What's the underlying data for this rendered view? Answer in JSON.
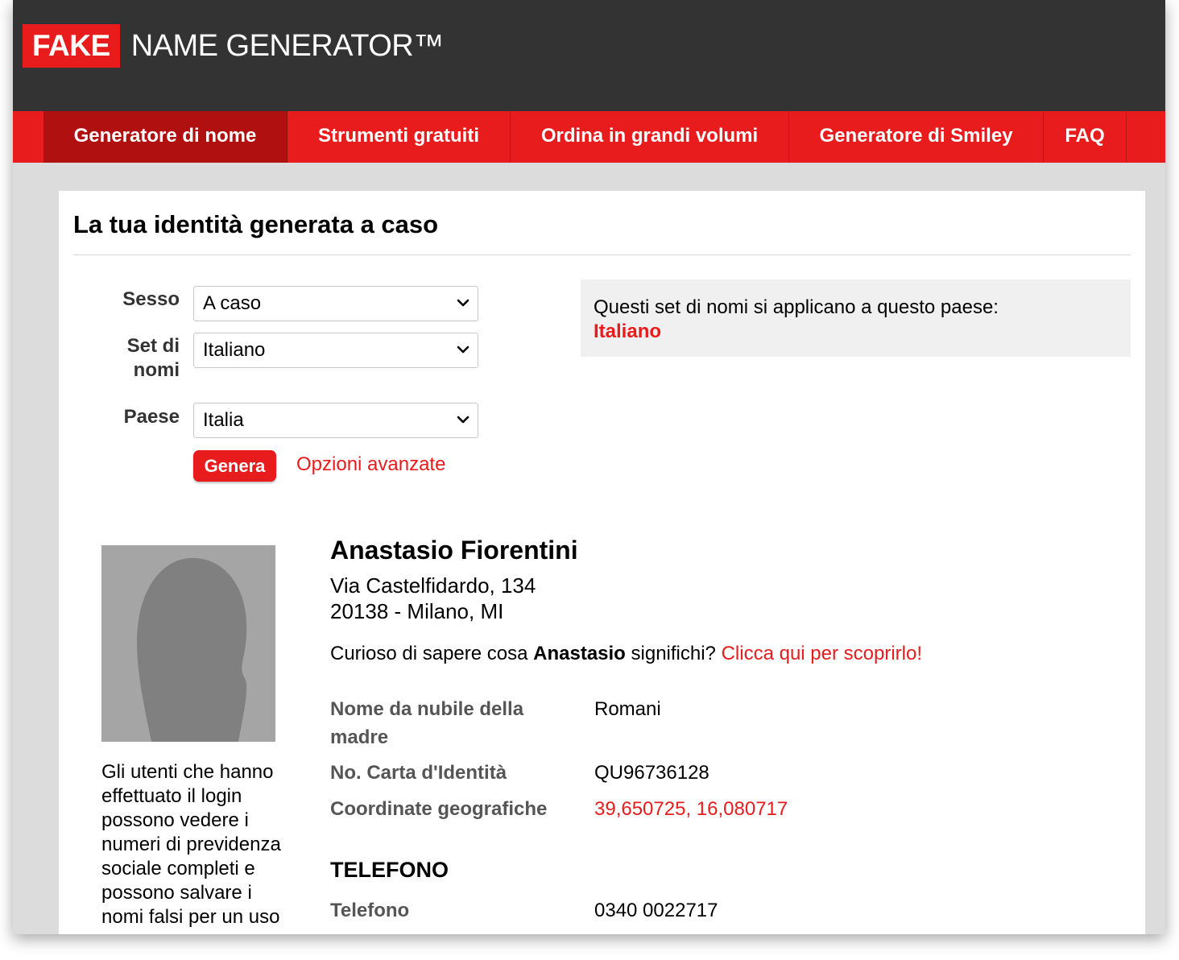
{
  "header": {
    "logo_fake": "FAKE",
    "logo_rest": "NAME GENERATOR™"
  },
  "nav": {
    "items": [
      {
        "label": "Generatore di nome"
      },
      {
        "label": "Strumenti gratuiti"
      },
      {
        "label": "Ordina in grandi volumi"
      },
      {
        "label": "Generatore di Smiley"
      },
      {
        "label": "FAQ"
      }
    ],
    "active_index": 0
  },
  "page_title": "La tua identità generata a caso",
  "form": {
    "sesso_label": "Sesso",
    "sesso_value": "A caso",
    "nameset_label_line1": "Set di",
    "nameset_label_line2": "nomi",
    "nameset_value": "Italiano",
    "paese_label": "Paese",
    "paese_value": "Italia",
    "generate_button": "Genera",
    "advanced_link": "Opzioni avanzate"
  },
  "info_box": {
    "text": "Questi set di nomi si applicano a questo paese:",
    "country": "Italiano"
  },
  "identity": {
    "name": "Anastasio Fiorentini",
    "address_line1": "Via Castelfidardo, 134",
    "address_line2": "20138 - Milano, MI",
    "curious_prefix": "Curioso di sapere cosa",
    "curious_name": "Anastasio",
    "curious_suffix": "significhi?",
    "curious_link": "Clicca qui per scoprirlo!",
    "details": {
      "maiden_label_line1": "Nome da nubile della",
      "maiden_label_line2": "madre",
      "maiden_value": "Romani",
      "id_label": "No. Carta d'Identità",
      "id_value": "QU96736128",
      "geo_label": "Coordinate geografiche",
      "geo_value": "39,650725, 16,080717"
    },
    "phone_section": "TELEFONO",
    "phone_label": "Telefono",
    "phone_value": "0340 0022717"
  },
  "sidebar_note": {
    "lines": [
      "Gli utenti che hanno",
      "effettuato il login",
      "possono vedere i",
      "numeri di previdenza",
      "sociale completi e",
      "possono salvare i",
      "nomi falsi per un uso"
    ]
  },
  "colors": {
    "brand_red": "#e81c1c",
    "header_dark": "#333333",
    "nav_active": "#b01010"
  }
}
